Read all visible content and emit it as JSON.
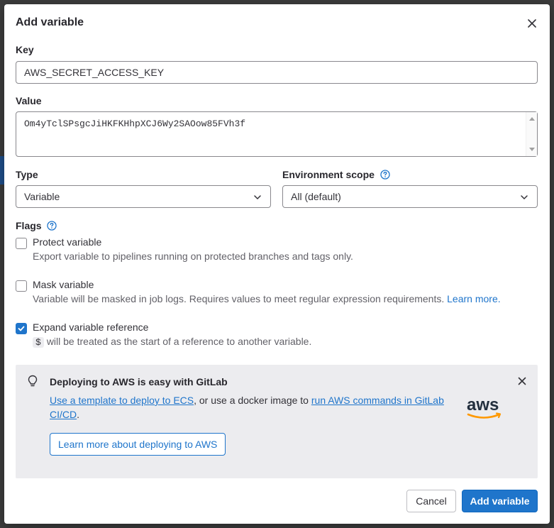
{
  "dialog": {
    "title": "Add variable"
  },
  "key": {
    "label": "Key",
    "value": "AWS_SECRET_ACCESS_KEY"
  },
  "value": {
    "label": "Value",
    "value": "Om4yTclSPsgcJiHKFKHhpXCJ6Wy2SAOow85FVh3f"
  },
  "type": {
    "label": "Type",
    "selected": "Variable"
  },
  "environment_scope": {
    "label": "Environment scope",
    "selected": "All (default)"
  },
  "flags": {
    "label": "Flags",
    "protect": {
      "label": "Protect variable",
      "help": "Export variable to pipelines running on protected branches and tags only.",
      "checked": false
    },
    "mask": {
      "label": "Mask variable",
      "help": "Variable will be masked in job logs. Requires values to meet regular expression requirements.",
      "link": "Learn more.",
      "checked": false
    },
    "expand": {
      "label": "Expand variable reference",
      "code": "$",
      "help": "will be treated as the start of a reference to another variable.",
      "checked": true
    }
  },
  "alert": {
    "title": "Deploying to AWS is easy with GitLab",
    "link1": "Use a template to deploy to ECS",
    "text1": ", or use a docker image to ",
    "link2": "run AWS commands in GitLab CI/CD",
    "text2": ".",
    "button": "Learn more about deploying to AWS",
    "logo_text": "aws"
  },
  "footer": {
    "cancel": "Cancel",
    "submit": "Add variable"
  },
  "colors": {
    "accent": "#1f75cb",
    "aws_orange": "#ff9900",
    "alert_bg": "#ececef"
  }
}
